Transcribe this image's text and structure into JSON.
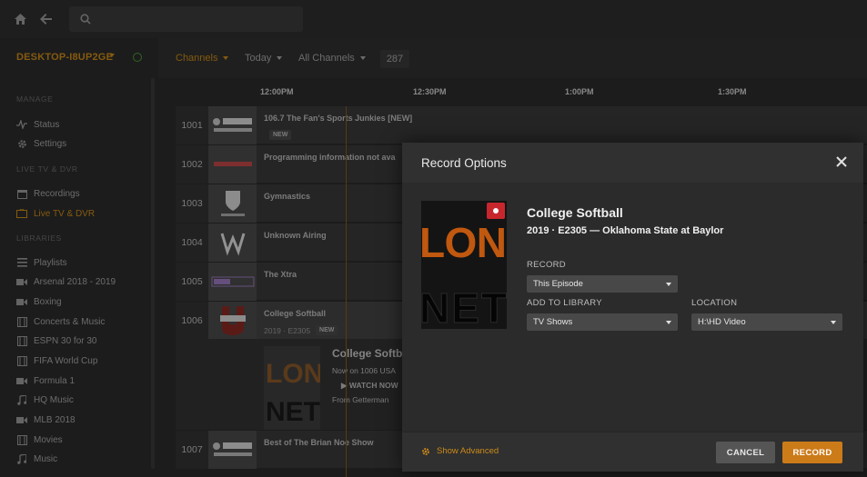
{
  "sidebar": {
    "server_name": "DESKTOP-I8UP2GE",
    "sections": {
      "manage": "MANAGE",
      "livetv": "LIVE TV & DVR",
      "libraries": "LIBRARIES"
    },
    "items": [
      {
        "label": "Status"
      },
      {
        "label": "Settings"
      },
      {
        "label": "Recordings"
      },
      {
        "label": "Live TV & DVR"
      },
      {
        "label": "Playlists"
      },
      {
        "label": "Arsenal 2018 - 2019"
      },
      {
        "label": "Boxing"
      },
      {
        "label": "Concerts & Music"
      },
      {
        "label": "ESPN 30 for 30"
      },
      {
        "label": "FIFA World Cup"
      },
      {
        "label": "Formula 1"
      },
      {
        "label": "HQ Music"
      },
      {
        "label": "MLB 2018"
      },
      {
        "label": "Movies"
      },
      {
        "label": "Music"
      }
    ]
  },
  "header": {
    "channels": "Channels",
    "today": "Today",
    "all_channels": "All Channels",
    "count": "287"
  },
  "timeline": [
    "12:00PM",
    "12:30PM",
    "1:00PM",
    "1:30PM"
  ],
  "guide": {
    "rows": [
      {
        "num": "1001",
        "program": "106.7 The Fan's Sports Junkies [NEW]",
        "badge": "NEW"
      },
      {
        "num": "1002",
        "program": "Programming information not ava"
      },
      {
        "num": "1003",
        "program": "Gymnastics"
      },
      {
        "num": "1004",
        "program": "Unknown Airing"
      },
      {
        "num": "1005",
        "program": "The Xtra"
      },
      {
        "num": "1006",
        "program": "College Softball",
        "sub": "2019 · E2305",
        "badge": "NEW"
      },
      {
        "num": "1007",
        "program": "Best of The Brian Noe Show"
      }
    ],
    "expanded": {
      "title": "College Softb",
      "line1": "Now on 1006 USA",
      "watch": "WATCH NOW",
      "line3": "From Getterman"
    }
  },
  "modal": {
    "title": "Record Options",
    "show_title": "College Softball",
    "show_sub": "2019 · E2305 — Oklahoma State at Baylor",
    "record_label": "RECORD",
    "record_value": "This Episode",
    "library_label": "ADD TO LIBRARY",
    "library_value": "TV Shows",
    "location_label": "LOCATION",
    "location_value": "H:\\HD Video",
    "show_advanced": "Show Advanced",
    "cancel": "CANCEL",
    "record": "RECORD",
    "accent": "#cc7b19"
  }
}
